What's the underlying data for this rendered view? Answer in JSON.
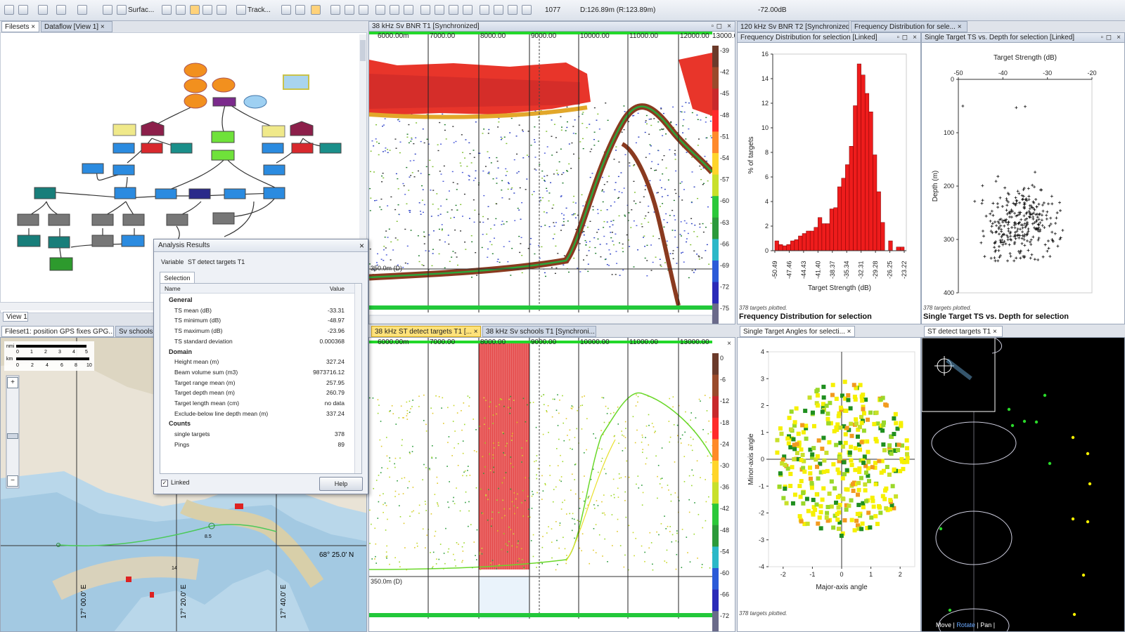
{
  "toolbar": {
    "surface_label": "Surfac...",
    "track_label": "Track...",
    "ping_value": "1077",
    "depth_readout": "D:126.89m (R:123.89m)",
    "db_readout": "-72.00dB"
  },
  "left_tabs": {
    "filesets": "Filesets",
    "dataflow": "Dataflow [View 1]",
    "view": "View 1"
  },
  "map_tabs": {
    "gps": "Fileset1: position GPS fixes GPG...",
    "schools": "Sv schools"
  },
  "map": {
    "nmi_label": "nmi",
    "nmi_ticks": [
      "0",
      "1",
      "2",
      "3",
      "4",
      "5"
    ],
    "km_label": "km",
    "km_ticks": [
      "0",
      "2",
      "4",
      "6",
      "8",
      "10"
    ],
    "latitude": "68° 25.0' N",
    "longitudes": [
      "17° 00.0' E",
      "17° 20.0' E",
      "17° 40.0' E"
    ],
    "waypoints": [
      "8.5",
      "14"
    ]
  },
  "echo_top": {
    "title": "38 kHz Sv BNR T1 [Synchronized]",
    "ruler": [
      "6000.00m",
      "7000.00",
      "8000.00",
      "9000.00",
      "10000.00",
      "11000.00",
      "12000.00",
      "13000.00"
    ],
    "depth_label": "350.0m (D)",
    "scale": [
      "-39",
      "-42",
      "-45",
      "-48",
      "-51",
      "-54",
      "-57",
      "-60",
      "-63",
      "-66",
      "-69",
      "-72",
      "-75"
    ]
  },
  "echo_bottom": {
    "tab_active": "38 kHz ST detect targets T1 [...",
    "tab_other": "38 kHz Sv schools T1 [Synchroni...",
    "ruler": [
      "6000.00m",
      "7000.00",
      "8000.00",
      "9000.00",
      "10000.00",
      "11000.00",
      "13000.00"
    ],
    "depth_label": "350.0m (D)",
    "scale": [
      "0",
      "-6",
      "-12",
      "-18",
      "-24",
      "-30",
      "-36",
      "-42",
      "-48",
      "-54",
      "-60",
      "-66",
      "-72"
    ]
  },
  "right_tabs": {
    "t1": "120 kHz Sv BNR T2 [Synchronized]",
    "t2": "Frequency Distribution for sele...",
    "angles": "Single Target Angles for selecti...",
    "st": "ST detect targets T1"
  },
  "freq": {
    "title": "Frequency Distribution for selection [Linked]",
    "caption": "Frequency Distribution for selection",
    "note": "378 targets plotted."
  },
  "ts_depth": {
    "title": "Single Target TS vs. Depth for selection [Linked]",
    "caption": "Single Target TS vs. Depth for selection",
    "note": "378 targets plotted."
  },
  "angles": {
    "note": "378 targets plotted."
  },
  "target3d": {
    "menu_move": "Move",
    "menu_rotate": "Rotate",
    "menu_pan": "Pan"
  },
  "dialog": {
    "title": "Analysis Results",
    "variable_label": "Variable",
    "variable_value": "ST detect targets T1",
    "tab": "Selection",
    "col_name": "Name",
    "col_value": "Value",
    "rows": [
      {
        "name": "General",
        "value": "",
        "header": true
      },
      {
        "name": "TS mean (dB)",
        "value": "-33.31"
      },
      {
        "name": "TS minimum (dB)",
        "value": "-48.97"
      },
      {
        "name": "TS maximum (dB)",
        "value": "-23.96"
      },
      {
        "name": "TS standard deviation",
        "value": "0.000368"
      },
      {
        "name": "Domain",
        "value": "",
        "header": true
      },
      {
        "name": "Height mean (m)",
        "value": "327.24"
      },
      {
        "name": "Beam volume sum (m3)",
        "value": "9873716.12"
      },
      {
        "name": "Target range mean (m)",
        "value": "257.95"
      },
      {
        "name": "Target depth mean (m)",
        "value": "260.79"
      },
      {
        "name": "Target length mean (cm)",
        "value": "no data"
      },
      {
        "name": "Exclude-below line depth mean (m)",
        "value": "337.24"
      },
      {
        "name": "Counts",
        "value": "",
        "header": true
      },
      {
        "name": "single targets",
        "value": "378"
      },
      {
        "name": "Pings",
        "value": "89"
      }
    ],
    "linked_label": "Linked",
    "help_label": "Help"
  },
  "chart_data": [
    {
      "type": "bar",
      "title": "Frequency Distribution for selection",
      "xlabel": "Target Strength (dB)",
      "ylabel": "% of targets",
      "ylim": [
        0,
        16
      ],
      "yticks": [
        "0",
        "2",
        "4",
        "6",
        "8",
        "10",
        "12",
        "14",
        "16"
      ],
      "xticks": [
        "-50.49",
        "-47.46",
        "-44.43",
        "-41.40",
        "-38.37",
        "-35.34",
        "-32.31",
        "-29.28",
        "-26.25",
        "-23.22"
      ],
      "bin_start": -50.49,
      "bin_width": 1.01,
      "values": [
        0.8,
        0.5,
        0.4,
        0.5,
        0.8,
        0.9,
        1.2,
        1.4,
        1.6,
        1.6,
        1.9,
        2.7,
        2.2,
        2.2,
        3.4,
        3.5,
        5.2,
        5.9,
        7.0,
        8.5,
        11.8,
        15.2,
        14.3,
        12.8,
        11.3,
        7.8,
        4.8,
        2.3,
        0.0,
        0.8,
        0.0,
        0.3,
        0.3
      ]
    },
    {
      "type": "scatter",
      "title": "Single Target TS vs. Depth for selection",
      "xlabel": "Target Strength (dB)",
      "ylabel": "Depth (m)",
      "xlim": [
        -50,
        -20
      ],
      "ylim": [
        400,
        0
      ],
      "xticks": [
        "-50",
        "-40",
        "-30",
        "-20"
      ],
      "yticks": [
        "0",
        "100",
        "200",
        "300",
        "400"
      ],
      "points_note": "378 targets plotted."
    },
    {
      "type": "scatter",
      "title": "Single Target Angles",
      "xlabel": "Major-axis angle",
      "ylabel": "Minor-axis angle",
      "xlim": [
        -2.5,
        2.5
      ],
      "ylim": [
        -4,
        4
      ],
      "xticks": [
        "-2",
        "-1",
        "0",
        "1",
        "2"
      ],
      "yticks": [
        "-4",
        "-3",
        "-2",
        "-1",
        "0",
        "1",
        "2",
        "3",
        "4"
      ]
    }
  ]
}
